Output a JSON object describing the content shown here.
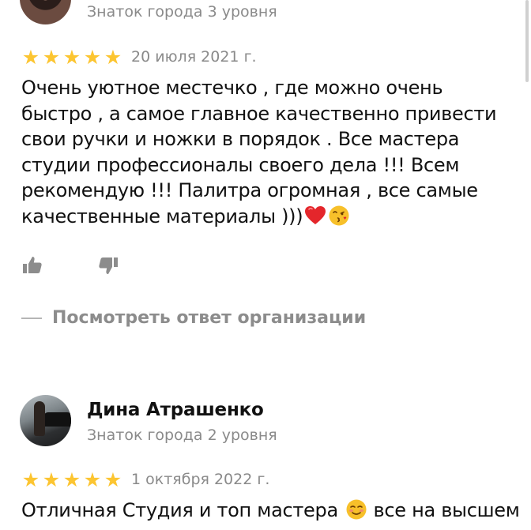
{
  "reviews": [
    {
      "author_level": "Знаток города 3 уровня",
      "rating": 5,
      "date": "20 июля 2021 г.",
      "text": "Очень уютное местечко , где можно очень быстро , а самое главное качественно привести свои ручки и ножки в порядок . Все мастера студии профессионалы своего дела !!! Всем рекомендую !!! Палитра огромная , все самые качественные материалы )))",
      "emoji": [
        "heart",
        "kissing-face"
      ],
      "reply_link": "Посмотреть ответ организации"
    },
    {
      "author_name": "Дина Атрашенко",
      "author_level": "Знаток города 2 уровня",
      "rating": 5,
      "date": "1 октября 2022 г.",
      "text": "Отличная Студия и топ мастера",
      "text_after_emoji": "все на высшем",
      "emoji": [
        "smiling-face"
      ]
    }
  ],
  "icons": {
    "star": "★",
    "like": "thumbs-up-icon",
    "dislike": "thumbs-down-icon"
  },
  "colors": {
    "star": "#fcc531",
    "muted_text": "#8a8a8a"
  }
}
